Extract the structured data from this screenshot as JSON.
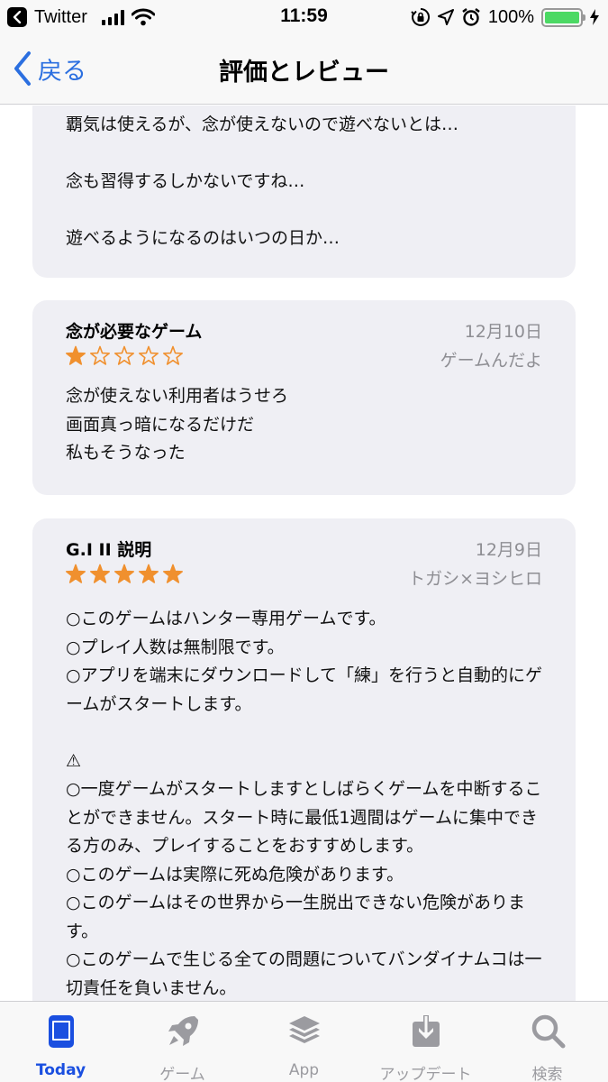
{
  "status_bar": {
    "back_app": "Twitter",
    "time": "11:59",
    "battery_percent": "100%",
    "battery_level": 1.0,
    "battery_color": "#4cd964",
    "icons": [
      "cellular-signal-icon",
      "wifi-icon",
      "orientation-lock-icon",
      "location-icon",
      "alarm-icon",
      "battery-icon",
      "charging-bolt-icon"
    ]
  },
  "nav": {
    "back_label": "戻る",
    "title": "評価とレビュー",
    "accent_color": "#2b6fe0"
  },
  "reviews": [
    {
      "title": "",
      "date": "",
      "author": "",
      "rating": null,
      "body": "覇気は使えるが、念が使えないので遊べないとは…\n\n念も習得するしかないですね…\n\n遊べるようになるのはいつの日か…"
    },
    {
      "title": "念が必要なゲーム",
      "date": "12月10日",
      "author": "ゲームんだよ",
      "rating": 1,
      "body": "念が使えない利用者はうせろ\n画面真っ暗になるだけだ\n私もそうなった"
    },
    {
      "title": "G.I II 説明",
      "date": "12月9日",
      "author": "トガシ×ヨシヒロ",
      "rating": 5,
      "body": "○このゲームはハンター専用ゲームです。\n○プレイ人数は無制限です。\n○アプリを端末にダウンロードして「練」を行うと自動的にゲームがスタートします。\n\n⚠\n○一度ゲームがスタートしますとしばらくゲームを中断することができません。スタート時に最低1週間はゲームに集中できる方のみ、プレイすることをおすすめします。\n○このゲームは実際に死ぬ危険があります。\n○このゲームはその世界から一生脱出できない危険があります。\n○このゲームで生じる全ての問題についてバンダイナムコは一切責任を負いません。"
    }
  ],
  "star_color": "#f0902e",
  "tabs": [
    {
      "label": "Today",
      "icon": "today-icon",
      "active": true
    },
    {
      "label": "ゲーム",
      "icon": "rocket-icon",
      "active": false
    },
    {
      "label": "App",
      "icon": "apps-stack-icon",
      "active": false
    },
    {
      "label": "アップデート",
      "icon": "updates-download-icon",
      "active": false
    },
    {
      "label": "検索",
      "icon": "search-icon",
      "active": false
    }
  ]
}
